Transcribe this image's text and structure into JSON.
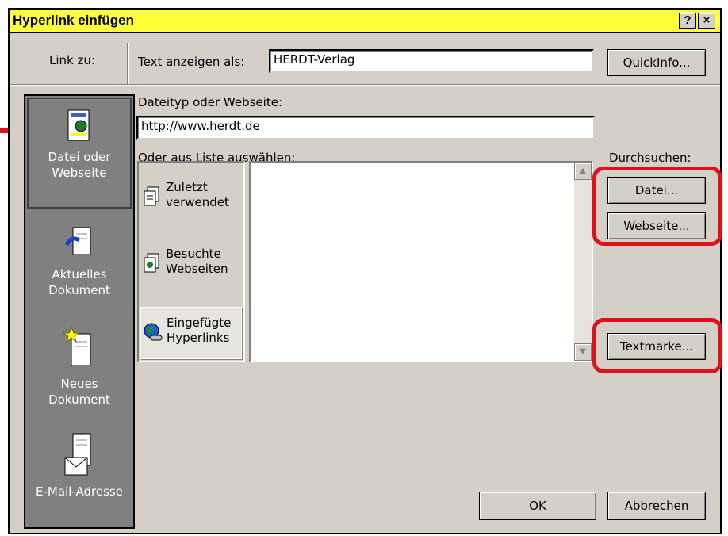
{
  "window": {
    "title": "Hyperlink einfügen",
    "help_label": "?",
    "close_label": "×",
    "title_bg": "#ffff3a"
  },
  "link_zu_label": "Link zu:",
  "text_anzeigen": {
    "label": "Text anzeigen als:",
    "value": "HERDT-Verlag"
  },
  "quickinfo_label": "QuickInfo...",
  "address": {
    "label": "Dateityp oder Webseite:",
    "value": "http://www.herdt.de"
  },
  "list_label": "Oder aus Liste auswählen:",
  "browse_label": "Durchsuchen:",
  "sidebar": {
    "items": [
      {
        "line1": "Datei oder",
        "line2": "Webseite",
        "icon": "web-page-icon",
        "selected": true
      },
      {
        "line1": "Aktuelles",
        "line2": "Dokument",
        "icon": "current-document-icon"
      },
      {
        "line1": "Neues",
        "line2": "Dokument",
        "icon": "new-document-icon"
      },
      {
        "line1": "E-Mail-Adresse",
        "line2": "",
        "icon": "email-icon"
      }
    ]
  },
  "list_sources": [
    {
      "line1": "Zuletzt",
      "line2": "verwendet",
      "icon": "recent-files-icon"
    },
    {
      "line1": "Besuchte",
      "line2": "Webseiten",
      "icon": "visited-pages-icon"
    },
    {
      "line1": "Eingefügte",
      "line2": "Hyperlinks",
      "icon": "inserted-links-icon",
      "selected": true
    }
  ],
  "buttons": {
    "datei": "Datei...",
    "webseite": "Webseite...",
    "textmarke": "Textmarke...",
    "ok": "OK",
    "abbrechen": "Abbrechen"
  },
  "highlight_color": "#e0101a"
}
